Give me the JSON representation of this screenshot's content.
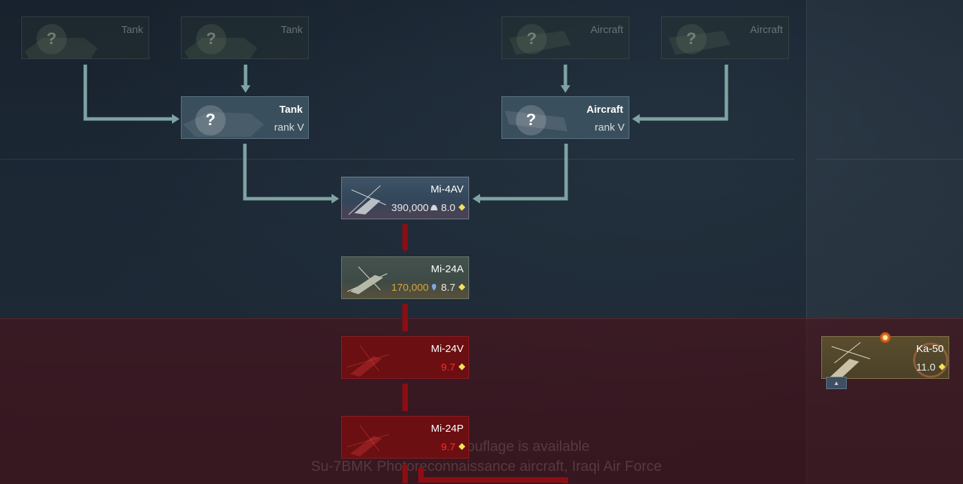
{
  "requirements_top": [
    {
      "label": "Tank",
      "icon": "question-mark"
    },
    {
      "label": "Tank",
      "icon": "question-mark"
    },
    {
      "label": "Aircraft",
      "icon": "question-mark"
    },
    {
      "label": "Aircraft",
      "icon": "question-mark"
    }
  ],
  "requirements_mid": [
    {
      "label": "Tank",
      "rank": "rank V",
      "icon": "question-mark"
    },
    {
      "label": "Aircraft",
      "rank": "rank V",
      "icon": "question-mark"
    }
  ],
  "vehicles": [
    {
      "name": "Mi-4AV",
      "cost": "390,000",
      "br": "8.0",
      "state": "researchable"
    },
    {
      "name": "Mi-24A",
      "cost": "170,000",
      "br": "8.7",
      "state": "researched"
    },
    {
      "name": "Mi-24V",
      "br": "9.7",
      "state": "locked"
    },
    {
      "name": "Mi-24P",
      "br": "9.7",
      "state": "locked"
    }
  ],
  "side_vehicle": {
    "name": "Ka-50",
    "br": "11.0",
    "state": "premium"
  },
  "overlay_text": {
    "line1": "Ultimate camouflage is available",
    "line2": "Su-7BMK Photoreconnaissance aircraft, Iraqi Air Force"
  },
  "colors": {
    "connector": "#7ea3a3",
    "locked_connector": "#8c0d12",
    "br_diamond": "#f5e15a",
    "gold_cost": "#d6a23a",
    "locked_br": "#ff2a2a"
  }
}
